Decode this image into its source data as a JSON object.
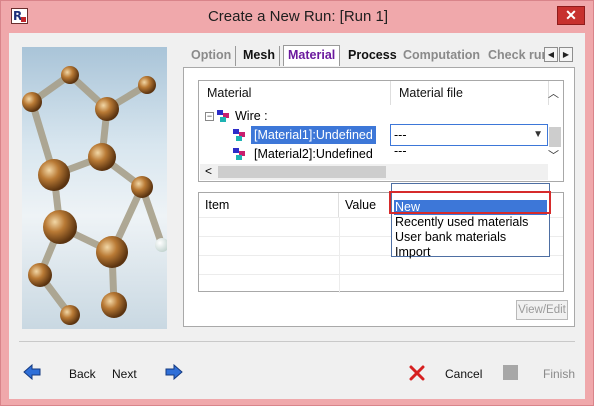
{
  "window": {
    "title": "Create a New Run: [Run 1]",
    "close_glyph": "✕",
    "app_icon_letter": "R"
  },
  "tabs": [
    {
      "label": "Option",
      "state": "inactive"
    },
    {
      "label": "Mesh",
      "state": "enabled"
    },
    {
      "label": "Material",
      "state": "selected"
    },
    {
      "label": "Process",
      "state": "enabled"
    },
    {
      "label": "Computation",
      "state": "inactive"
    },
    {
      "label": "Check rur",
      "state": "inactive"
    }
  ],
  "tab_scroll": {
    "left": "◀",
    "right": "▶"
  },
  "material_grid": {
    "columns": [
      "Material",
      "Material file"
    ],
    "tree": {
      "root_label": "Wire :",
      "root_expander": "−",
      "children": [
        {
          "label": "[Material1]:Undefined",
          "file": "---",
          "selected": true
        },
        {
          "label": "[Material2]:Undefined",
          "file": "---",
          "selected": false
        }
      ]
    },
    "scroll_up": "︿",
    "scroll_down": "﹀",
    "scroll_left": "<"
  },
  "combo": {
    "value": "---",
    "arrow": "▼"
  },
  "dropdown": {
    "options": [
      "---",
      "New",
      "Recently used materials",
      "User bank materials",
      "Import"
    ],
    "highlighted_index": 1
  },
  "property_grid": {
    "columns": [
      "Item",
      "Value"
    ]
  },
  "view_edit_label": "View/Edit",
  "footer": {
    "back_label": "Back",
    "next_label": "Next",
    "cancel_label": "Cancel",
    "finish_label": "Finish"
  },
  "colors": {
    "title_bar": "#f0a8ab",
    "selection": "#3d77d8",
    "selected_tab_text": "#6b1a9e",
    "highlight_frame": "#d62b2b",
    "nav_arrow": "#2f6fd8",
    "cancel_x": "#d62020"
  },
  "icons": [
    "app-icon",
    "close-icon",
    "tree-node-icon",
    "back-arrow-icon",
    "next-arrow-icon",
    "cancel-icon",
    "finish-icon"
  ]
}
